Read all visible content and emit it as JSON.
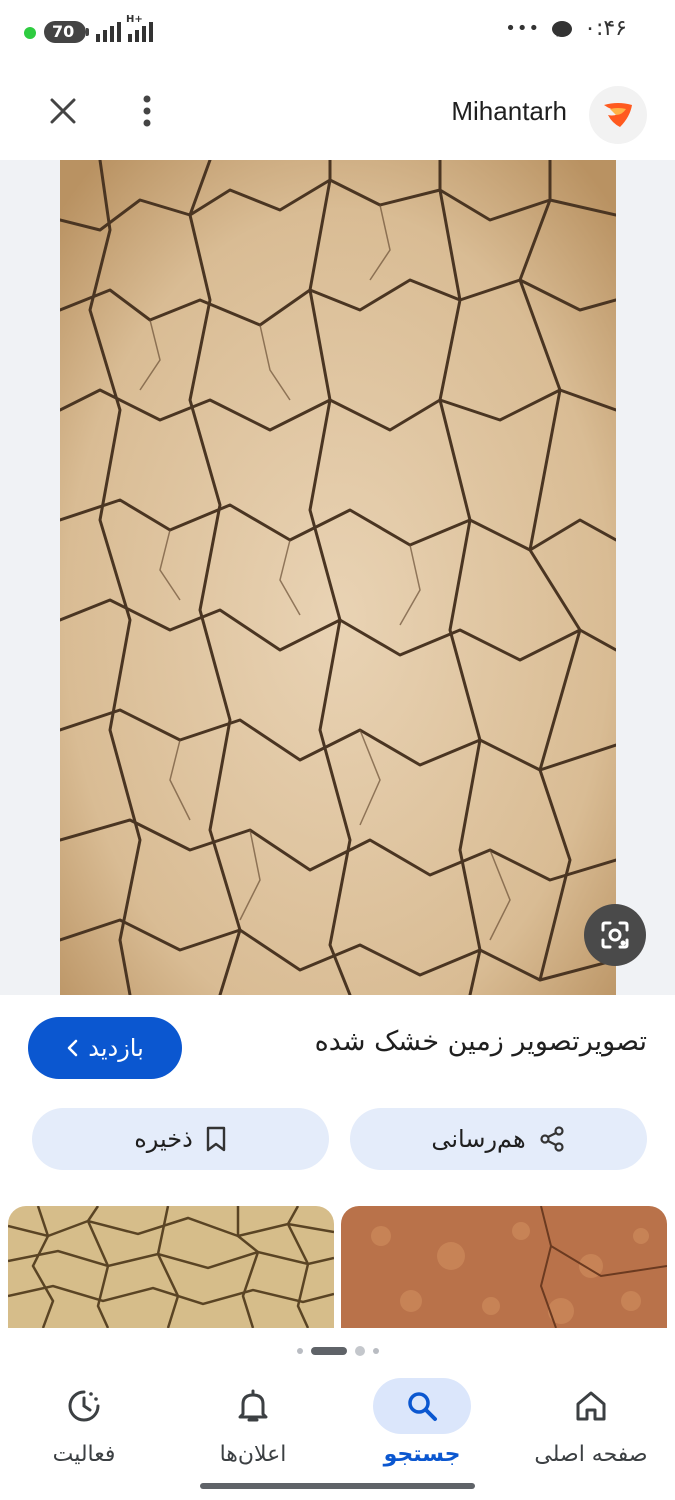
{
  "status_bar": {
    "battery": "70",
    "network": "H+",
    "time": "۰:۴۶",
    "overflow": "•••"
  },
  "header": {
    "site_name": "Mihantarh",
    "close_icon": "close-icon",
    "more_icon": "more-vert-icon"
  },
  "image": {
    "subject": "cracked dry earth texture",
    "lens_icon": "google-lens-icon"
  },
  "info": {
    "title": "تصویرتصویر زمین خشک شده",
    "visit_label": "بازدید",
    "share_label": "هم‌رسانی",
    "save_label": "ذخیره"
  },
  "bottom_nav": {
    "items": [
      {
        "label": "صفحه اصلی",
        "icon": "home-icon"
      },
      {
        "label": "جستجو",
        "icon": "search-icon"
      },
      {
        "label": "اعلان‌ها",
        "icon": "bell-icon"
      },
      {
        "label": "فعالیت",
        "icon": "activity-icon"
      }
    ]
  },
  "colors": {
    "accent": "#0b57d0",
    "chip_bg": "#e4ecfa",
    "image_bg": "#f0f2f5"
  }
}
